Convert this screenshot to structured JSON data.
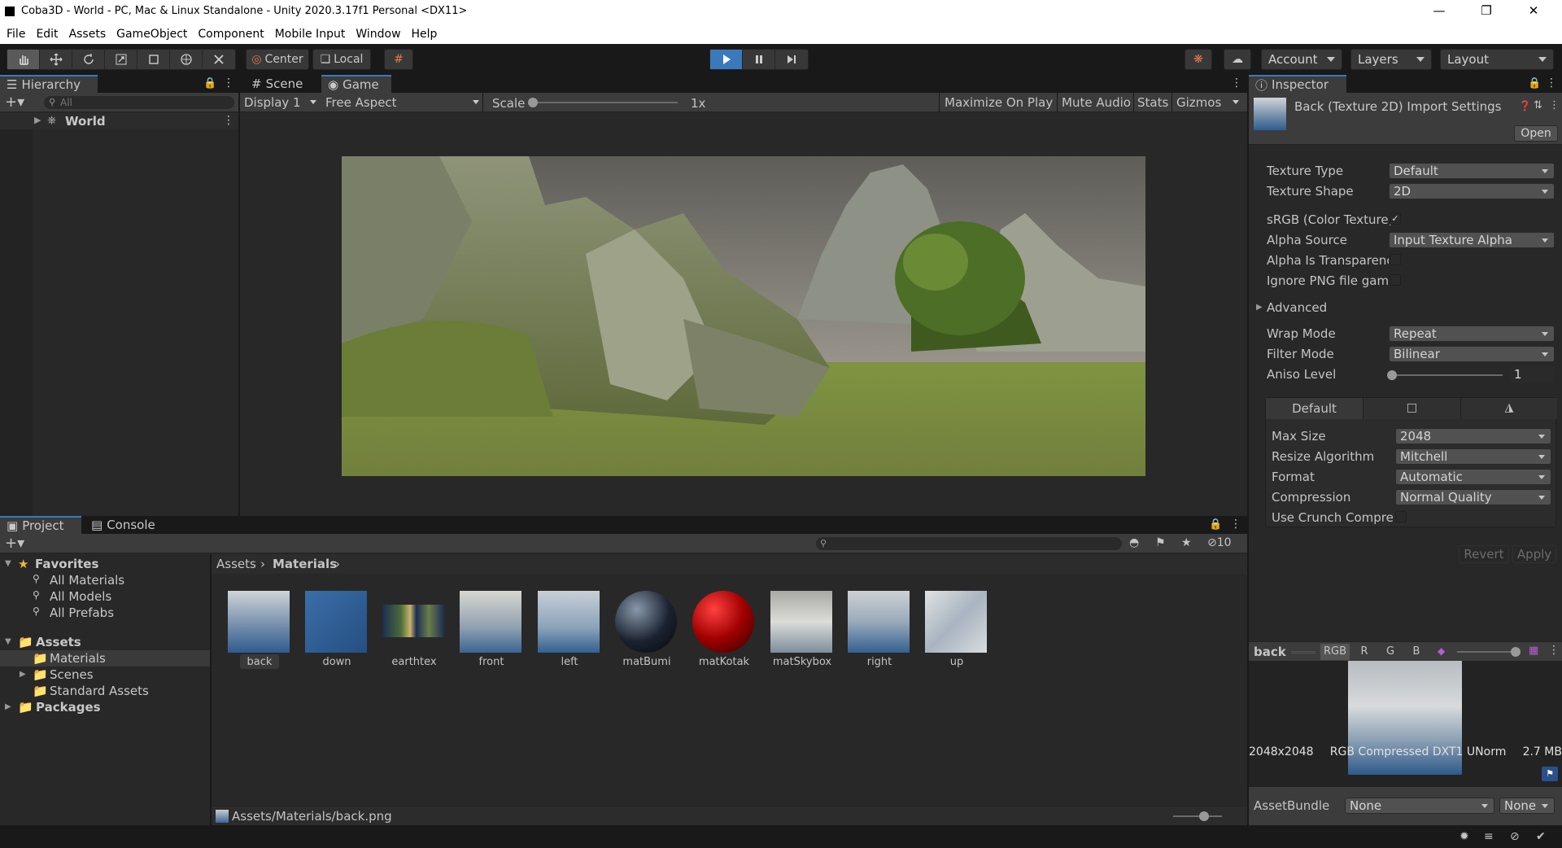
{
  "window": {
    "title": "Coba3D - World - PC, Mac & Linux Standalone - Unity 2020.3.17f1 Personal <DX11>"
  },
  "menu": [
    "File",
    "Edit",
    "Assets",
    "GameObject",
    "Component",
    "Mobile Input",
    "Window",
    "Help"
  ],
  "toolbar": {
    "center_label": "Center",
    "local_label": "Local",
    "account_label": "Account",
    "layers_label": "Layers",
    "layout_label": "Layout"
  },
  "hierarchy": {
    "tab": "Hierarchy",
    "search_placeholder": "All",
    "root_item": "World"
  },
  "game": {
    "scene_tab": "Scene",
    "game_tab": "Game",
    "display": "Display 1",
    "aspect": "Free Aspect",
    "scale_label": "Scale",
    "scale_value": "1x",
    "scale_fraction": 0.0,
    "maximize": "Maximize On Play",
    "mute": "Mute Audio",
    "stats": "Stats",
    "gizmos": "Gizmos"
  },
  "project": {
    "project_tab": "Project",
    "console_tab": "Console",
    "hidden_count": "10",
    "favorites": {
      "label": "Favorites",
      "items": [
        "All Materials",
        "All Models",
        "All Prefabs"
      ]
    },
    "assets": {
      "label": "Assets",
      "items": [
        "Materials",
        "Scenes",
        "Standard Assets"
      ]
    },
    "packages": "Packages",
    "breadcrumb": [
      "Assets",
      "Materials"
    ],
    "files": [
      "back",
      "down",
      "earthtex",
      "front",
      "left",
      "matBumi",
      "matKotak",
      "matSkybox",
      "right",
      "up"
    ],
    "status_path": "Assets/Materials/back.png"
  },
  "inspector": {
    "tab": "Inspector",
    "header": "Back (Texture 2D) Import Settings",
    "open_button": "Open",
    "texture_type": {
      "label": "Texture Type",
      "value": "Default"
    },
    "texture_shape": {
      "label": "Texture Shape",
      "value": "2D"
    },
    "srgb": {
      "label": "sRGB (Color Texture)",
      "checked": true
    },
    "alpha_source": {
      "label": "Alpha Source",
      "value": "Input Texture Alpha"
    },
    "alpha_transparency": {
      "label": "Alpha Is Transparenc",
      "checked": false
    },
    "ignore_png": {
      "label": "Ignore PNG file gamr",
      "checked": false
    },
    "advanced": "Advanced",
    "wrap_mode": {
      "label": "Wrap Mode",
      "value": "Repeat"
    },
    "filter_mode": {
      "label": "Filter Mode",
      "value": "Bilinear"
    },
    "aniso": {
      "label": "Aniso Level",
      "value": "1",
      "fraction": 0.0
    },
    "platform_tab": "Default",
    "max_size": {
      "label": "Max Size",
      "value": "2048"
    },
    "resize": {
      "label": "Resize Algorithm",
      "value": "Mitchell"
    },
    "format": {
      "label": "Format",
      "value": "Automatic"
    },
    "compression": {
      "label": "Compression",
      "value": "Normal Quality"
    },
    "crunch": {
      "label": "Use Crunch Compres",
      "checked": false
    },
    "revert": "Revert",
    "apply": "Apply",
    "preview": {
      "name": "back",
      "channels": [
        "RGB",
        "R",
        "G",
        "B"
      ],
      "info_size": "2048x2048",
      "info_format": "RGB Compressed DXT1 UNorm",
      "info_mem": "2.7 MB"
    },
    "asset_bundle": {
      "label": "AssetBundle",
      "value": "None",
      "variant": "None"
    }
  },
  "colors": {
    "accent": "#3a79bb",
    "panel": "#282828",
    "header": "#3c3c3c",
    "background": "#191919"
  }
}
